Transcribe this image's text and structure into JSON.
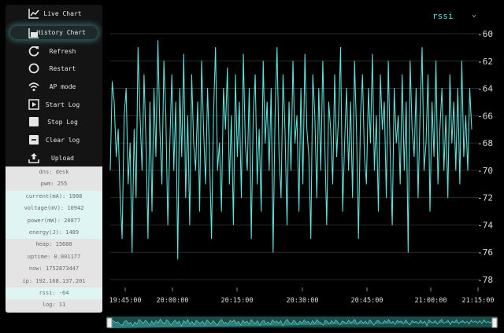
{
  "menu": [
    {
      "label": "Live Chart",
      "icon": "line-chart-icon",
      "active": false
    },
    {
      "label": "History Chart",
      "icon": "history-chart-icon",
      "active": true
    },
    {
      "label": "Refresh",
      "icon": "refresh-icon",
      "active": false
    },
    {
      "label": "Restart",
      "icon": "restart-icon",
      "active": false
    },
    {
      "label": "AP mode",
      "icon": "wifi-icon",
      "active": false
    },
    {
      "label": "Start Log",
      "icon": "play-icon",
      "active": false
    },
    {
      "label": "Stop Log",
      "icon": "stop-icon",
      "active": false
    },
    {
      "label": "Clear log",
      "icon": "clear-icon",
      "active": false
    },
    {
      "label": "Upload",
      "icon": "upload-icon",
      "active": false
    }
  ],
  "status": [
    {
      "text": "dns: desk",
      "alt": false
    },
    {
      "text": "pwm: 255",
      "alt": false
    },
    {
      "text": "current(mA): 1908",
      "alt": true
    },
    {
      "text": "voltage(mV): 10942",
      "alt": true
    },
    {
      "text": "power(mW): 20877",
      "alt": true
    },
    {
      "text": "energy(J): 1489",
      "alt": true
    },
    {
      "text": "heap: 15680",
      "alt": false
    },
    {
      "text": "uptime: 0.001177",
      "alt": false
    },
    {
      "text": "now: 1752873447",
      "alt": false
    },
    {
      "text": "ip: 192.168.137.201",
      "alt": false
    },
    {
      "text": "rssi: -64",
      "alt": true
    },
    {
      "text": "log: 11",
      "alt": false
    }
  ],
  "series_selector": {
    "value": "rssi"
  },
  "colors": {
    "accent": "#5fe0d8",
    "background": "#000000",
    "sidebar": "#141414",
    "status_panel": "#e4e4e4",
    "grid": "#2a2a2a"
  },
  "chart_data": {
    "type": "line",
    "series": [
      {
        "name": "rssi"
      }
    ],
    "x_ticks": [
      "19:45:00",
      "20:00:00",
      "20:15:00",
      "20:30:00",
      "20:45:00",
      "21:00:00",
      "21:15:00"
    ],
    "y_ticks": [
      -60,
      -62,
      -64,
      -66,
      -68,
      -70,
      -72,
      -74,
      -76,
      -78
    ],
    "ylim": [
      -78,
      -60
    ],
    "grid": true,
    "x_minutes": [
      0,
      0.5,
      1,
      1.5,
      2,
      2.5,
      3,
      3.5,
      4,
      4.5,
      5,
      5.5,
      6,
      6.5,
      7,
      7.5,
      8,
      8.5,
      9,
      9.5,
      10,
      10.5,
      11,
      11.5,
      12,
      12.5,
      13,
      13.5,
      14,
      14.5,
      15,
      15.5,
      16,
      16.5,
      17,
      17.5,
      18,
      18.5,
      19,
      19.5,
      20,
      20.5,
      21,
      21.5,
      22,
      22.5,
      23,
      23.5,
      24,
      24.5,
      25,
      25.5,
      26,
      26.5,
      27,
      27.5,
      28,
      28.5,
      29,
      29.5,
      30,
      30.5,
      31,
      31.5,
      32,
      32.5,
      33,
      33.5,
      34,
      34.5,
      35,
      35.5,
      36,
      36.5,
      37,
      37.5,
      38,
      38.5,
      39,
      39.5,
      40,
      40.5,
      41,
      41.5,
      42,
      42.5,
      43,
      43.5,
      44,
      44.5,
      45,
      45.5,
      46,
      46.5,
      47,
      47.5,
      48,
      48.5,
      49,
      49.5,
      50,
      50.5,
      51,
      51.5,
      52,
      52.5,
      53,
      53.5,
      54,
      54.5,
      55,
      55.5,
      56,
      56.5,
      57,
      57.5,
      58,
      58.5,
      59,
      59.5,
      60,
      60.5,
      61,
      61.5,
      62,
      62.5,
      63,
      63.5,
      64,
      64.5,
      65,
      65.5,
      66,
      66.5,
      67,
      67.5,
      68,
      68.5,
      69,
      69.5,
      70,
      70.5,
      71,
      71.5,
      72,
      72.5,
      73,
      73.5,
      74,
      74.5,
      75,
      75.5,
      76,
      76.5,
      77,
      77.5,
      78,
      78.5,
      79,
      79.5,
      80,
      80.5,
      81,
      81.5,
      82,
      82.5,
      83,
      83.5,
      84,
      84.5,
      85,
      85.5,
      86,
      86.5,
      87,
      87.5,
      88,
      88.5,
      89,
      89.5,
      90,
      90.5,
      91
    ],
    "values": [
      -70,
      -63.5,
      -65,
      -69,
      -67,
      -72,
      -75,
      -66,
      -64,
      -71,
      -68,
      -76,
      -67,
      -72,
      -61,
      -66,
      -70,
      -63,
      -68,
      -75,
      -65,
      -73,
      -64,
      -69,
      -60.5,
      -67,
      -71,
      -62,
      -66,
      -74,
      -68,
      -63,
      -70,
      -65,
      -76.5,
      -64,
      -69,
      -61.5,
      -72,
      -66,
      -74,
      -63,
      -68,
      -70,
      -65,
      -73,
      -62,
      -67,
      -71,
      -64,
      -69,
      -75,
      -66,
      -61,
      -70,
      -68,
      -73,
      -64,
      -67,
      -62.5,
      -71,
      -66,
      -74,
      -63,
      -69,
      -65,
      -72,
      -61.5,
      -68,
      -70,
      -64,
      -75,
      -66,
      -63,
      -71,
      -67,
      -73,
      -62,
      -68,
      -65,
      -70,
      -64,
      -76,
      -66,
      -61,
      -69,
      -72,
      -63,
      -67,
      -74,
      -65,
      -70,
      -62,
      -68,
      -66,
      -73,
      -64,
      -71,
      -61.5,
      -67,
      -69,
      -75,
      -63,
      -66,
      -72,
      -64,
      -70,
      -62,
      -68,
      -74,
      -65,
      -67,
      -71,
      -63,
      -69,
      -66,
      -61,
      -73,
      -68,
      -64,
      -70,
      -65,
      -72,
      -62,
      -67,
      -75,
      -66,
      -63,
      -69,
      -71,
      -64,
      -68,
      -61.5,
      -70,
      -66,
      -73,
      -63,
      -67,
      -65,
      -72,
      -62,
      -69,
      -74,
      -64,
      -68,
      -66,
      -71,
      -63,
      -70,
      -65,
      -76,
      -62,
      -67,
      -69,
      -64,
      -72,
      -66,
      -61,
      -70,
      -68,
      -63,
      -73,
      -65,
      -69,
      -62,
      -71,
      -67,
      -64,
      -70,
      -66,
      -72,
      -63,
      -68,
      -65,
      -70,
      -64,
      -71,
      -62,
      -69,
      -66,
      -70,
      -64,
      -67,
      -65,
      -68
    ]
  }
}
